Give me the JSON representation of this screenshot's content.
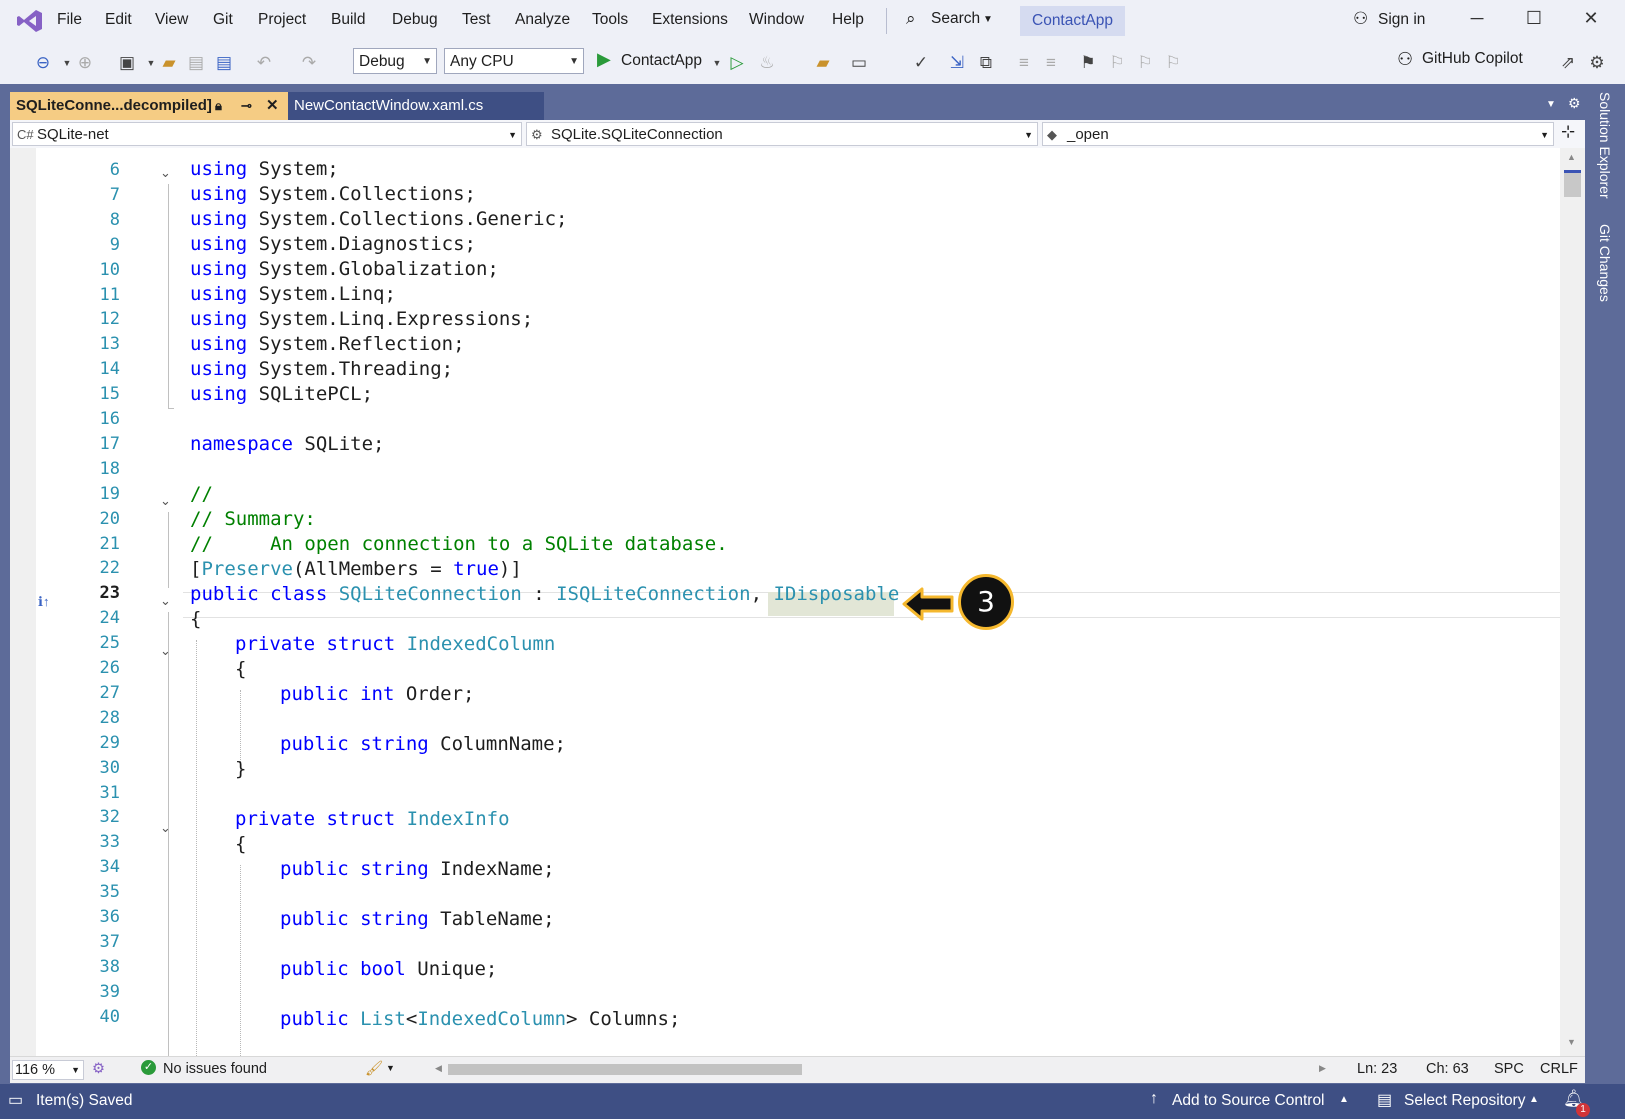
{
  "menu": {
    "items": [
      "File",
      "Edit",
      "View",
      "Git",
      "Project",
      "Build",
      "Debug",
      "Test",
      "Analyze",
      "Tools",
      "Extensions",
      "Window",
      "Help"
    ],
    "search_label": "Search",
    "app_name": "ContactApp",
    "sign_in": "Sign in"
  },
  "toolbar": {
    "config": "Debug",
    "platform": "Any CPU",
    "run_target": "ContactApp",
    "copilot": "GitHub Copilot"
  },
  "tabs": [
    {
      "label": "SQLiteConne...decompiled]",
      "active": true
    },
    {
      "label": "NewContactWindow.xaml.cs",
      "active": false
    }
  ],
  "navbar": {
    "project": "SQLite-net",
    "type": "SQLite.SQLiteConnection",
    "member": "_open"
  },
  "code": {
    "line_numbers": [
      "6",
      "7",
      "8",
      "9",
      "10",
      "11",
      "12",
      "13",
      "14",
      "15",
      "16",
      "17",
      "18",
      "19",
      "20",
      "21",
      "22",
      "23",
      "24",
      "25",
      "26",
      "27",
      "28",
      "29",
      "30",
      "31",
      "32",
      "33",
      "34",
      "35",
      "36",
      "37",
      "38",
      "39",
      "40"
    ],
    "current_line": "23"
  },
  "callout": {
    "number": "3",
    "color": "#f5b82e"
  },
  "editor_status": {
    "zoom": "116 %",
    "issues": "No issues found",
    "line": "Ln: 23",
    "col": "Ch: 63",
    "whitespace": "SPC",
    "line_ending": "CRLF"
  },
  "side_panel": {
    "solution_explorer": "Solution Explorer",
    "git_changes": "Git Changes"
  },
  "status_bar": {
    "message": "Item(s) Saved",
    "source_control": "Add to Source Control",
    "repository": "Select Repository",
    "notifications": "1"
  },
  "colors": {
    "accent": "#5d6b99",
    "tab_active": "#f5cc84",
    "keyword": "#0000ff",
    "type": "#2b91af",
    "comment": "#008000"
  }
}
